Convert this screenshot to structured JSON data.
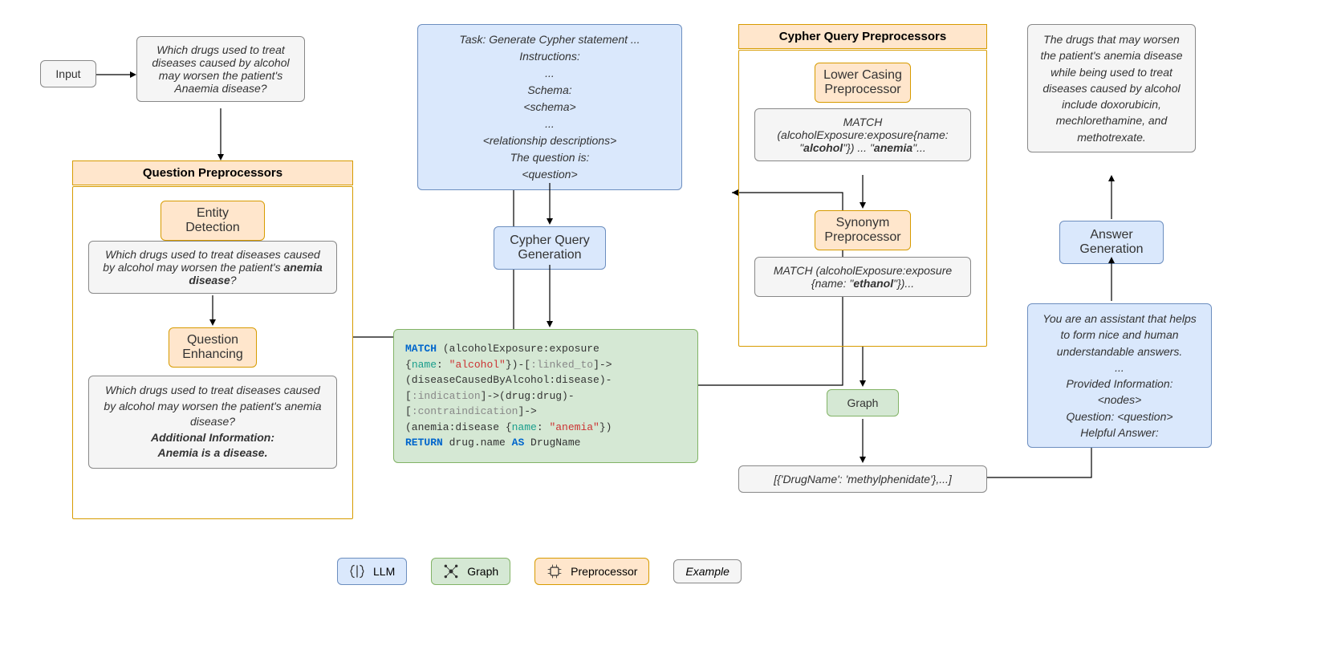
{
  "input_label": "Input",
  "question_box": "Which drugs used to treat diseases caused by alcohol may worsen the patient's Anaemia disease?",
  "qp_title": "Question Preprocessors",
  "qp_entity": "Entity Detection",
  "qp_entity_text_pre": "Which drugs used to treat diseases caused by alcohol may worsen the patient's ",
  "qp_entity_text_bold": "anemia disease",
  "qp_entity_text_post": "?",
  "qp_enhance": "Question Enhancing",
  "qp_enhance_text1": "Which drugs used to treat diseases caused by alcohol may worsen the patient's anemia disease?",
  "qp_enhance_text2a": "Additional Information:",
  "qp_enhance_text2b": "Anemia is a disease.",
  "prompt_box_l1": "Task: Generate Cypher statement ...",
  "prompt_box_l2": "Instructions:",
  "prompt_box_l3": "...",
  "prompt_box_l4": "Schema:",
  "prompt_box_l5": "<schema>",
  "prompt_box_l6": "...",
  "prompt_box_l7": "<relationship descriptions>",
  "prompt_box_l8": "The question is:",
  "prompt_box_l9": "<question>",
  "cypher_gen": "Cypher Query Generation",
  "cqp_title": "Cypher Query Preprocessors",
  "cqp_lower": "Lower Casing Preprocessor",
  "cqp_lower_text1": "MATCH (alcoholExposure:exposure{name: \"",
  "cqp_lower_bold1": "alcohol",
  "cqp_lower_text2": "\"}) ... \"",
  "cqp_lower_bold2": "anemia",
  "cqp_lower_text3": "\"...",
  "cqp_syn": "Synonym Preprocessor",
  "cqp_syn_text1": "MATCH (alcoholExposure:exposure {name: \"",
  "cqp_syn_bold": "ethanol",
  "cqp_syn_text2": "\"})...",
  "graph_label": "Graph",
  "graph_result": "[{'DrugName': 'methylphenidate'},...]",
  "answer_text": "The drugs that may worsen the patient's anemia disease while being used to treat diseases caused by alcohol include doxorubicin, mechlorethamine, and methotrexate.",
  "answer_gen": "Answer Generation",
  "answer_prompt_l1": "You are an assistant that helps to form nice and human understandable answers.",
  "answer_prompt_l2": "...",
  "answer_prompt_l3": "Provided Information:",
  "answer_prompt_l4": "<nodes>",
  "answer_prompt_l5": "Question: <question>",
  "answer_prompt_l6": "Helpful Answer:",
  "legend_llm": "LLM",
  "legend_graph": "Graph",
  "legend_pre": "Preprocessor",
  "legend_example": "Example",
  "chart_data": {
    "type": "diagram",
    "pipeline": [
      "Input",
      "Question Preprocessors (Entity Detection, Question Enhancing)",
      "Cypher Query Generation (with prompt template)",
      "Cypher code output",
      "Cypher Query Preprocessors (Lower Casing, Synonym)",
      "Graph execution",
      "Graph result list",
      "Answer Generation (with prompt template)",
      "Final answer text"
    ],
    "legend": {
      "LLM": "blue",
      "Graph": "green",
      "Preprocessor": "orange",
      "Example": "gray"
    }
  }
}
